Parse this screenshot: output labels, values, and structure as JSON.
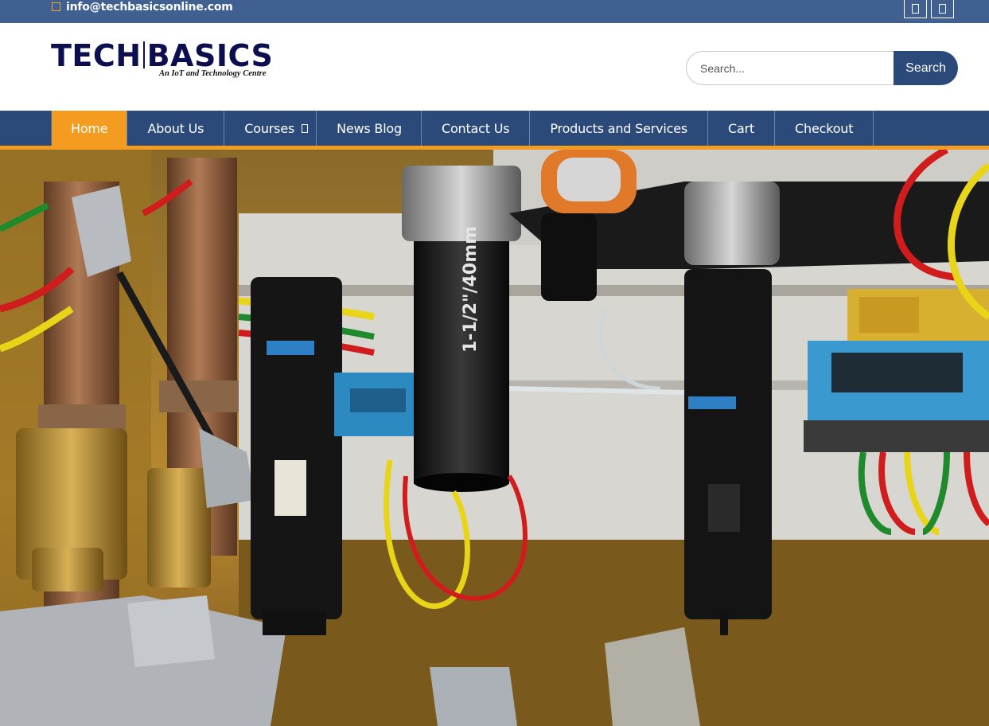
{
  "topbar": {
    "email": "info@techbasicsonline.com",
    "email_icon": "envelope-icon",
    "social_icons": [
      "facebook-icon",
      "twitter-icon"
    ]
  },
  "logo": {
    "left": "TECH",
    "right": "BASICS",
    "tagline": "An IoT and Technology Centre"
  },
  "search": {
    "placeholder": "Search...",
    "value": "",
    "button_label": "Search"
  },
  "nav": {
    "items": [
      {
        "label": "Home",
        "active": true
      },
      {
        "label": "About Us"
      },
      {
        "label": "Courses",
        "has_dropdown": true
      },
      {
        "label": "News Blog"
      },
      {
        "label": "Contact Us"
      },
      {
        "label": "Products and Services"
      },
      {
        "label": "Cart"
      },
      {
        "label": "Checkout"
      }
    ]
  },
  "hero": {
    "pipe_label": "1-1/2\"/40mm",
    "colors": {
      "accent_orange": "#f39c1f",
      "nav_blue": "#2b4a7a",
      "topbar_blue": "#3f6090"
    }
  }
}
